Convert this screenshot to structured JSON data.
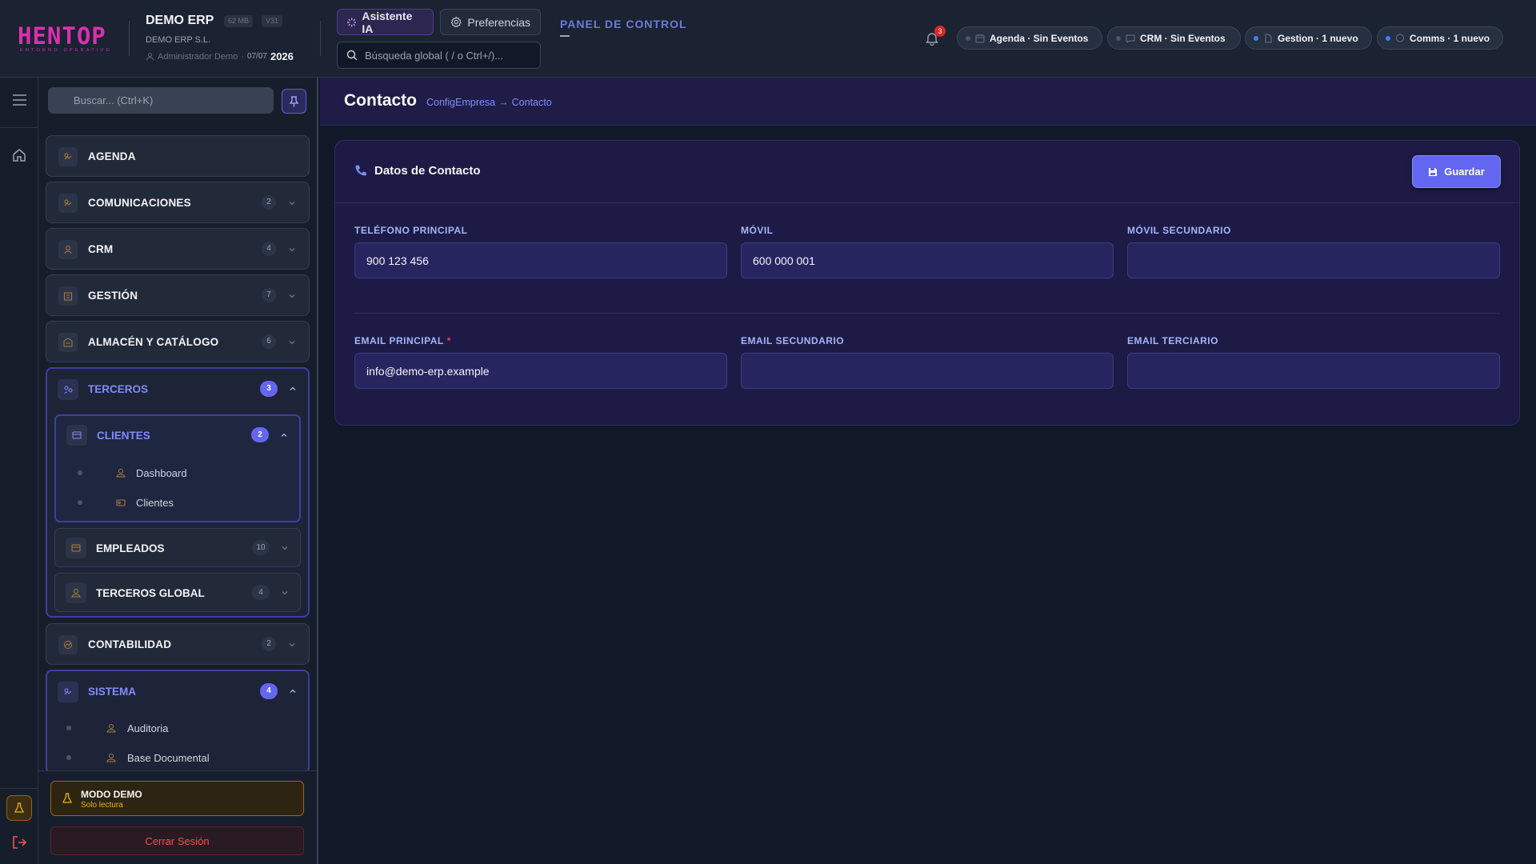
{
  "header": {
    "logo_text": "HENTOP",
    "logo_tagline": "ENTORNO OPERATIVO",
    "app_name": "DEMO ERP",
    "memory_badge": "62 MB",
    "version_badge": "V31",
    "company": "DEMO ERP S.L.",
    "user": "Administrador Demo",
    "separator": "·",
    "date": "07/07",
    "year": "2026",
    "ai_button": "Asistente IA",
    "prefs_button": "Preferencias",
    "search_placeholder": "Búsqueda global ( / o Ctrl+/)...",
    "panel_title": "PANEL DE CONTROL",
    "notifications_count": "3",
    "status_pills": [
      {
        "label": "Agenda · Sin Eventos",
        "active": false
      },
      {
        "label": "CRM · Sin Eventos",
        "active": false
      },
      {
        "label": "Gestion · 1 nuevo",
        "active": true
      },
      {
        "label": "Comms · 1 nuevo",
        "active": true
      }
    ]
  },
  "sidebar": {
    "search_placeholder": "Buscar... (Ctrl+K)",
    "items": [
      {
        "label": "AGENDA",
        "count": ""
      },
      {
        "label": "COMUNICACIONES",
        "count": "2"
      },
      {
        "label": "CRM",
        "count": "4"
      },
      {
        "label": "GESTIÓN",
        "count": "7"
      },
      {
        "label": "ALMACÉN Y CATÁLOGO",
        "count": "6"
      }
    ],
    "terceros": {
      "label": "TERCEROS",
      "count": "3",
      "clientes": {
        "label": "CLIENTES",
        "count": "2",
        "children": [
          "Dashboard",
          "Clientes"
        ]
      },
      "empleados": {
        "label": "EMPLEADOS",
        "count": "10"
      },
      "terceros_global": {
        "label": "TERCEROS GLOBAL",
        "count": "4"
      }
    },
    "contabilidad": {
      "label": "CONTABILIDAD",
      "count": "2"
    },
    "sistema": {
      "label": "SISTEMA",
      "count": "4",
      "children": [
        "Auditoria",
        "Base Documental"
      ]
    },
    "demo_title": "MODO DEMO",
    "demo_subtitle": "Solo lectura",
    "logout": "Cerrar Sesión"
  },
  "breadcrumb": {
    "title": "Contacto",
    "parent": "ConfigEmpresa",
    "arrow": "→",
    "current": "Contacto"
  },
  "card": {
    "title": "Datos de Contacto",
    "save_label": "Guardar",
    "fields": {
      "telefono_principal": {
        "label": "TELÉFONO PRINCIPAL",
        "value": "900 123 456"
      },
      "movil": {
        "label": "MÓVIL",
        "value": "600 000 001"
      },
      "movil_secundario": {
        "label": "MÓVIL SECUNDARIO",
        "value": ""
      },
      "email_principal": {
        "label": "EMAIL PRINCIPAL",
        "required_mark": "*",
        "value": "info@demo-erp.example"
      },
      "email_secundario": {
        "label": "EMAIL SECUNDARIO",
        "value": ""
      },
      "email_terciario": {
        "label": "EMAIL TERCIARIO",
        "value": ""
      }
    }
  },
  "colors": {
    "accent": "#6366f1",
    "logo": "#db2fb0",
    "danger": "#f05252",
    "warning": "#eab308"
  }
}
